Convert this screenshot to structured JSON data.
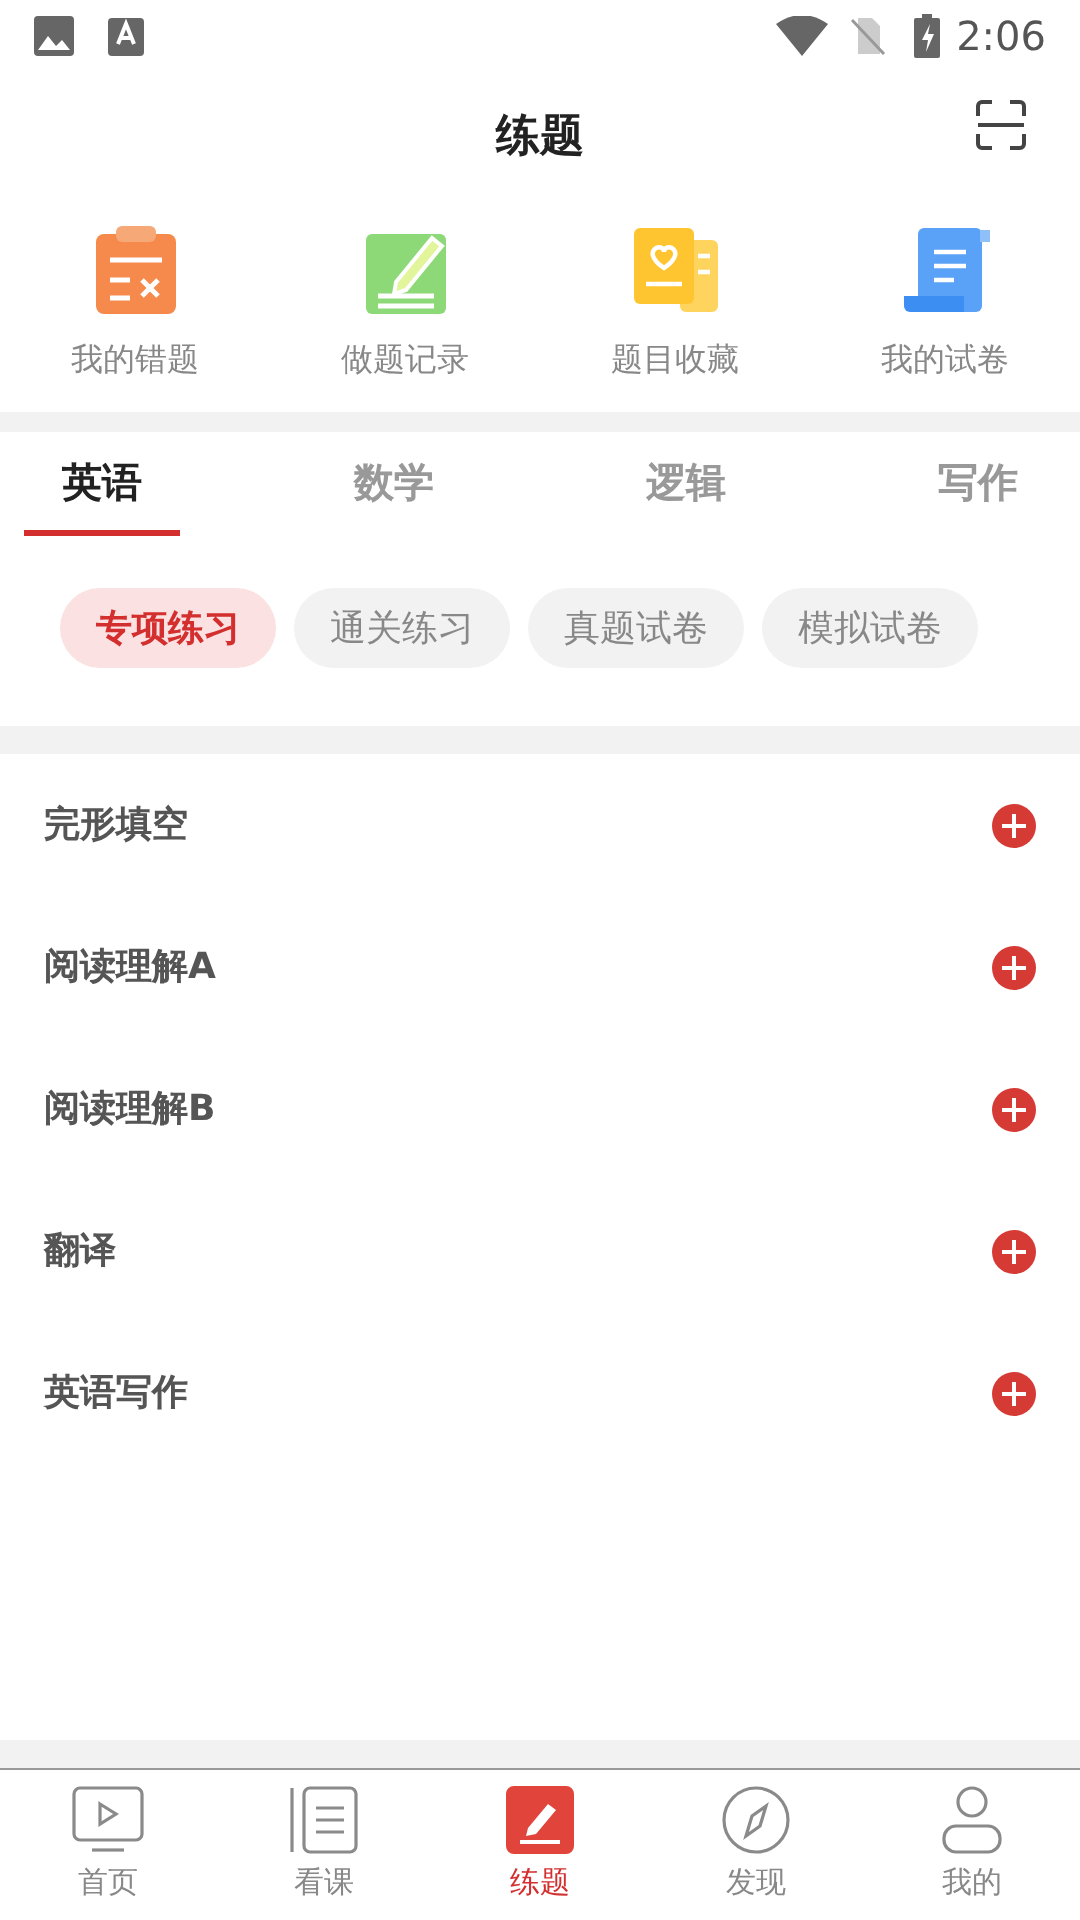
{
  "status_bar": {
    "time": "2:06"
  },
  "header": {
    "title": "练题"
  },
  "shortcuts": [
    {
      "kind": "wrong",
      "label": "我的错题"
    },
    {
      "kind": "record",
      "label": "做题记录"
    },
    {
      "kind": "favorite",
      "label": "题目收藏"
    },
    {
      "kind": "paper",
      "label": "我的试卷"
    }
  ],
  "subject_tabs": [
    {
      "label": "英语",
      "selected": true
    },
    {
      "label": "数学",
      "selected": false
    },
    {
      "label": "逻辑",
      "selected": false
    },
    {
      "label": "写作",
      "selected": false
    }
  ],
  "practice_types": [
    {
      "label": "专项练习",
      "selected": true
    },
    {
      "label": "通关练习",
      "selected": false
    },
    {
      "label": "真题试卷",
      "selected": false
    },
    {
      "label": "模拟试卷",
      "selected": false
    }
  ],
  "topics": [
    {
      "label": "完形填空"
    },
    {
      "label": "阅读理解A"
    },
    {
      "label": "阅读理解B"
    },
    {
      "label": "翻译"
    },
    {
      "label": "英语写作"
    }
  ],
  "bottom_nav": [
    {
      "kind": "home",
      "label": "首页",
      "selected": false
    },
    {
      "kind": "course",
      "label": "看课",
      "selected": false
    },
    {
      "kind": "practice",
      "label": "练题",
      "selected": true
    },
    {
      "kind": "discover",
      "label": "发现",
      "selected": false
    },
    {
      "kind": "me",
      "label": "我的",
      "selected": false
    }
  ]
}
